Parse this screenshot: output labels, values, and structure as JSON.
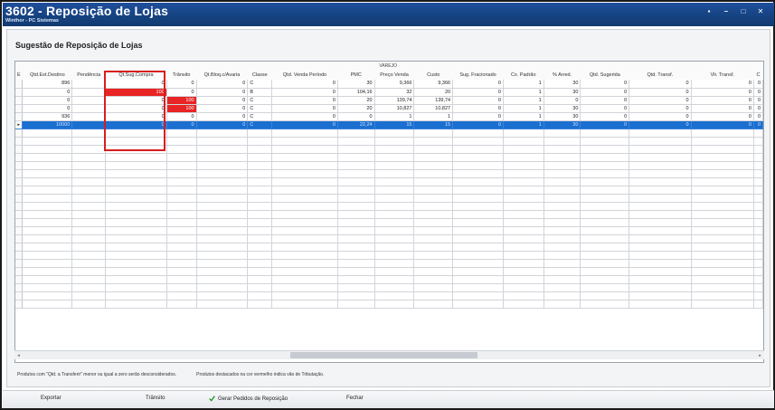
{
  "window": {
    "title": "3602 - Reposição de Lojas",
    "subtitle": "Winthor - PC Sistemas",
    "buttons": [
      "▪",
      "–",
      "□",
      "✕"
    ]
  },
  "page": {
    "heading": "Sugestão de Reposição de Lojas"
  },
  "grid": {
    "group_label": "VAREJO",
    "columns": [
      "Qtd.Est.Destino",
      "Pendência",
      "Qt.Sug.Compra",
      "Trânsito",
      "Qt.Bloq.c/Avaria",
      "Classe",
      "Qtd. Venda Período",
      "PMC",
      "Preço Venda",
      "Custo",
      "Sug. Fracionado",
      "Cx. Padrão",
      "% Arred.",
      "Qtd. Sugerida",
      "Qtd. Transf.",
      "Vlr. Transf."
    ],
    "first_col_cut": "E",
    "last_col_cut": "C",
    "rows": [
      [
        "896",
        "",
        "0",
        "0",
        "0",
        "C",
        "0",
        "30",
        "9,366",
        "9,366",
        "0",
        "1",
        "30",
        "0",
        "0",
        "0"
      ],
      [
        "0",
        "",
        "100",
        "0",
        "0",
        "B",
        "0",
        "104,16",
        "32",
        "20",
        "0",
        "1",
        "30",
        "0",
        "0",
        "0"
      ],
      [
        "0",
        "",
        "0",
        "100",
        "0",
        "C",
        "0",
        "20",
        "139,74",
        "139,74",
        "0",
        "1",
        "0",
        "0",
        "0",
        "0"
      ],
      [
        "0",
        "",
        "0",
        "100",
        "0",
        "C",
        "0",
        "20",
        "10,827",
        "10,827",
        "0",
        "1",
        "30",
        "0",
        "0",
        "0"
      ],
      [
        "936",
        "",
        "0",
        "0",
        "0",
        "C",
        "0",
        "0",
        "1",
        "1",
        "0",
        "1",
        "30",
        "0",
        "0",
        "0"
      ],
      [
        "10000",
        "",
        "0",
        "0",
        "0",
        "C",
        "0",
        "22,24",
        "15",
        "15",
        "0",
        "1",
        "30",
        "0",
        "0",
        "0"
      ]
    ],
    "last_col_values": [
      "0",
      "0",
      "0",
      "0",
      "0",
      "0"
    ],
    "row_indicator": "▸",
    "highlight_color": "#e82424",
    "selected_color": "#1a6fd1"
  },
  "legend": {
    "note1": "Produtos com \"Qtd. a Transferir\" menor ou igual a zero serão desconsiderados.",
    "note2": "Produtos destacados na cor vermelho indica vão de Tributação."
  },
  "toolbar": {
    "export_label": "Exportar",
    "transit_label": "Trânsito",
    "generate_label": "Gerar Pedidos de Reposição",
    "close_label": "Fechar"
  }
}
